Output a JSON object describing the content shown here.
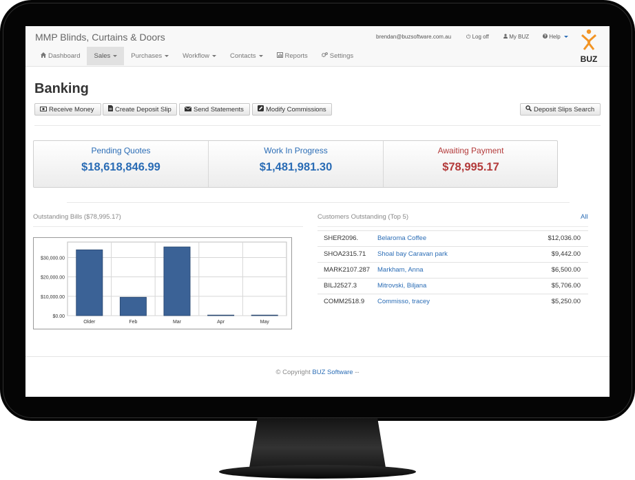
{
  "app": {
    "brand": "MMP Blinds, Curtains & Doors",
    "logo_text": "BUZ"
  },
  "user_menu": {
    "email": "brendan@buzsoftware.com.au",
    "logoff": "Log off",
    "mybuz": "My BUZ",
    "help": "Help"
  },
  "nav": [
    {
      "label": "Dashboard",
      "icon": "home-icon",
      "dropdown": false,
      "active": false
    },
    {
      "label": "Sales",
      "icon": "",
      "dropdown": true,
      "active": true
    },
    {
      "label": "Purchases",
      "icon": "",
      "dropdown": true,
      "active": false
    },
    {
      "label": "Workflow",
      "icon": "",
      "dropdown": true,
      "active": false
    },
    {
      "label": "Contacts",
      "icon": "",
      "dropdown": true,
      "active": false
    },
    {
      "label": "Reports",
      "icon": "bar-chart-icon",
      "dropdown": false,
      "active": false
    },
    {
      "label": "Settings",
      "icon": "gears-icon",
      "dropdown": false,
      "active": false
    }
  ],
  "page": {
    "title": "Banking"
  },
  "toolbar": {
    "receive_money": "Receive Money",
    "create_deposit_slip": "Create Deposit Slip",
    "send_statements": "Send Statements",
    "modify_commissions": "Modify Commissions",
    "deposit_slips_search": "Deposit Slips Search"
  },
  "stats": [
    {
      "label": "Pending Quotes",
      "value": "$18,618,846.99",
      "color": "#2a6cb5"
    },
    {
      "label": "Work In Progress",
      "value": "$1,481,981.30",
      "color": "#2a6cb5"
    },
    {
      "label": "Awaiting Payment",
      "value": "$78,995.17",
      "color": "#b33a3a"
    }
  ],
  "outstanding_bills": {
    "title": "Outstanding Bills ($78,995.17)"
  },
  "chart_data": {
    "type": "bar",
    "categories": [
      "Older",
      "Feb",
      "Mar",
      "Apr",
      "May"
    ],
    "values": [
      34000,
      9500,
      35500,
      300,
      300
    ],
    "ylim": [
      0,
      38000
    ],
    "y_ticks": [
      0,
      10000,
      20000,
      30000
    ],
    "y_tick_labels": [
      "$0.00",
      "$10,000.00",
      "$20,000.00",
      "$30,000.00"
    ],
    "bar_color": "#3b6296",
    "grid": true
  },
  "customers": {
    "title": "Customers Outstanding (Top 5)",
    "all_link": "All",
    "rows": [
      {
        "code": "SHER2096.",
        "name": "Belaroma Coffee",
        "amount": "$12,036.00"
      },
      {
        "code": "SHOA2315.71",
        "name": "Shoal bay Caravan park",
        "amount": "$9,442.00"
      },
      {
        "code": "MARK2107.287",
        "name": "Markham, Anna",
        "amount": "$6,500.00"
      },
      {
        "code": "BILJ2527.3",
        "name": "Mitrovski, Biljana",
        "amount": "$5,706.00"
      },
      {
        "code": "COMM2518.9",
        "name": "Commisso, tracey",
        "amount": "$5,250.00"
      }
    ]
  },
  "footer": {
    "prefix": "© Copyright",
    "link": "BUZ Software",
    "suffix": "--"
  }
}
